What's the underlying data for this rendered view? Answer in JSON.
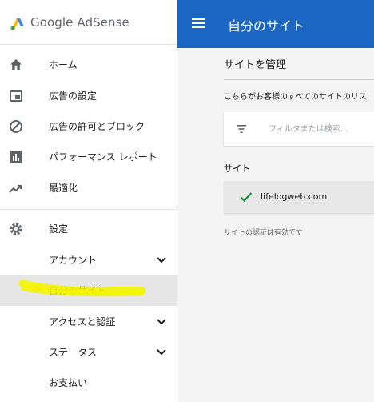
{
  "brand": {
    "name": "Google AdSense"
  },
  "sidebar": {
    "items": [
      {
        "label": "ホーム",
        "icon": "home-icon"
      },
      {
        "label": "広告の設定",
        "icon": "ad-settings-icon"
      },
      {
        "label": "広告の許可とブロック",
        "icon": "block-icon"
      },
      {
        "label": "パフォーマンス レポート",
        "icon": "bar-chart-icon"
      },
      {
        "label": "最適化",
        "icon": "trending-up-icon"
      },
      {
        "label": "設定",
        "icon": "gear-icon"
      },
      {
        "label": "アカウント",
        "expandable": true
      },
      {
        "label": "自分のサイト",
        "selected": true
      },
      {
        "label": "アクセスと認証",
        "expandable": true
      },
      {
        "label": "ステータス",
        "expandable": true
      },
      {
        "label": "お支払い"
      }
    ]
  },
  "header": {
    "title": "自分のサイト",
    "menu_icon": "hamburger-menu-icon"
  },
  "main": {
    "section_title": "サイトを管理",
    "description": "こちらがお客様のすべてのサイトのリス",
    "filter": {
      "placeholder": "フィルタまたは検索...",
      "value": ""
    },
    "sites_header": "サイト",
    "sites": [
      {
        "domain": "lifelogweb.com",
        "status_icon": "check-icon"
      }
    ],
    "verification_text": "サイトの認証は有効です"
  },
  "colors": {
    "topbar": "#1a66c2",
    "accent_check": "#1e8e3e",
    "selected_row": "#e6e6e6",
    "highlight_marker": "#f4f400",
    "content_bg": "#f4f4f4"
  }
}
